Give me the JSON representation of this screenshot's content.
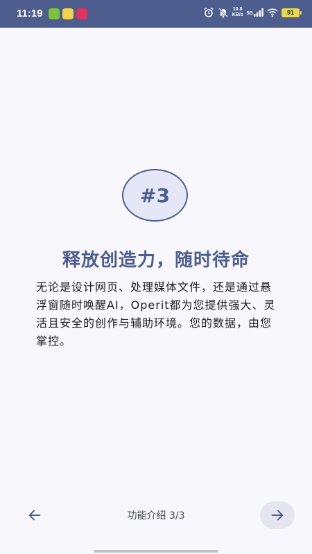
{
  "status_bar": {
    "time": "11:19",
    "net_speed_value": "10.8",
    "net_speed_unit": "KB/s",
    "network_type": "5G",
    "battery_level": "91"
  },
  "onboarding": {
    "step_badge": "#3",
    "title": "释放创造力，随时待命",
    "description": "无论是设计网页、处理媒体文件，还是通过悬浮窗随时唤醒AI，Operit都为您提供强大、灵活且安全的创作与辅助环境。您的数据，由您掌控。",
    "pager_text": "功能介绍 3/3"
  },
  "colors": {
    "status_bar_bg": "#4c5d8e",
    "accent": "#4c5d8e",
    "page_bg": "#f8f8fc",
    "badge_bg": "#e6e7f6",
    "next_button_bg": "#e4e5ef"
  },
  "icons": {
    "back": "arrow-left-icon",
    "next": "arrow-right-icon"
  }
}
